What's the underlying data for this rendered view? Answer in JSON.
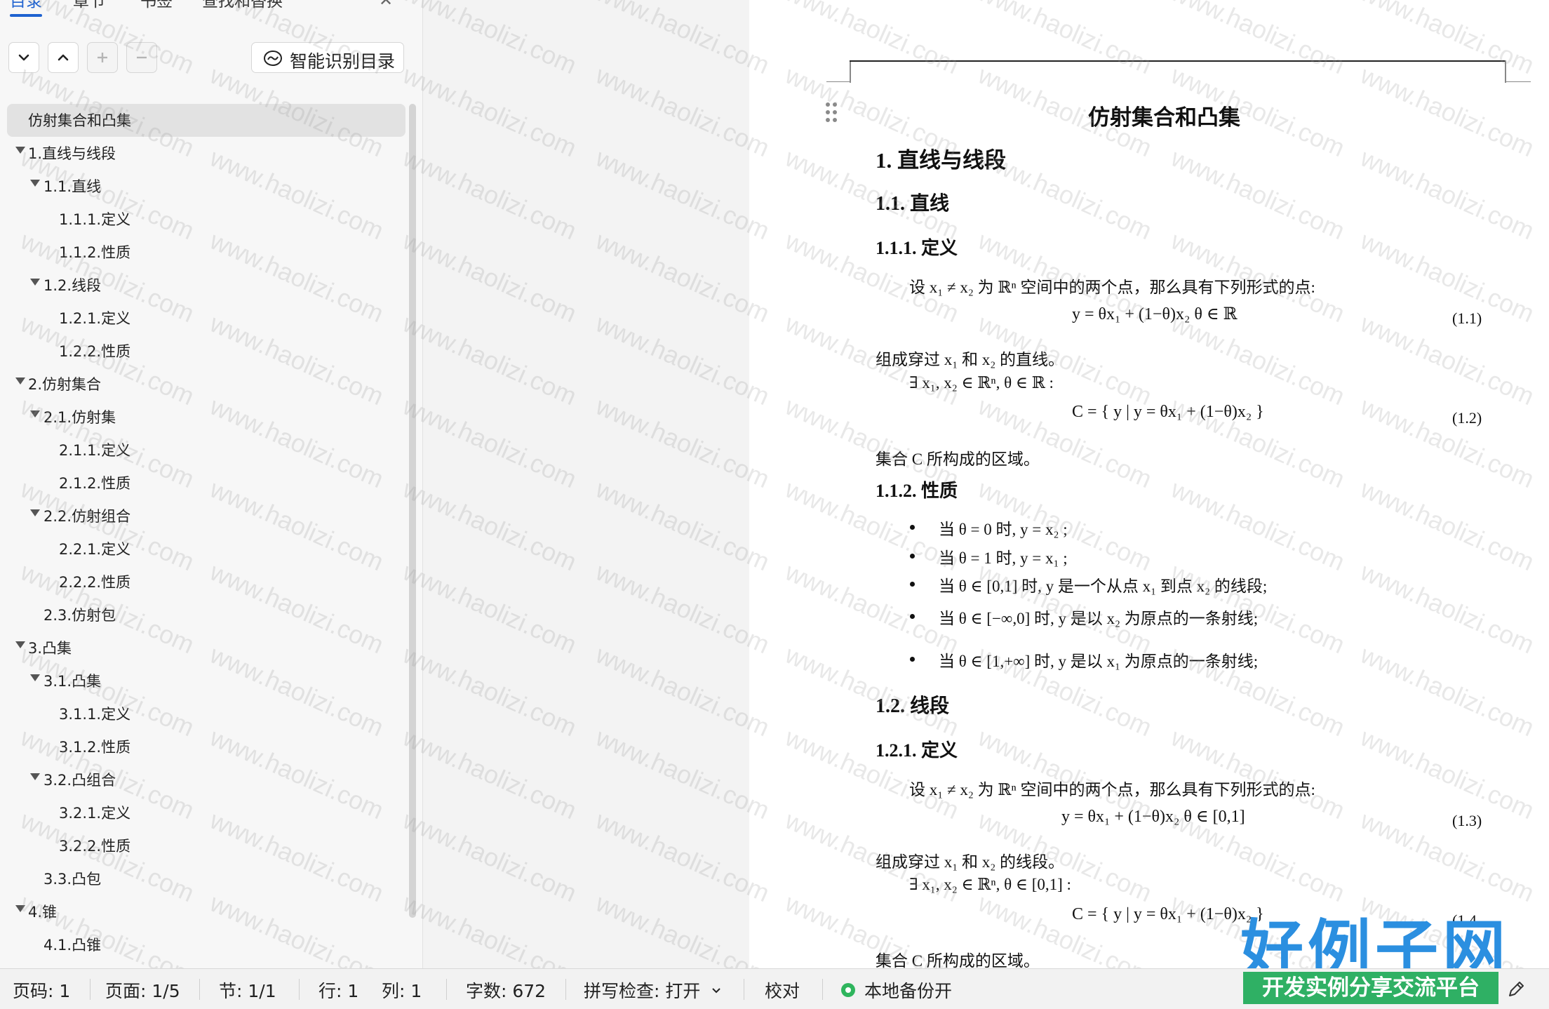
{
  "nav": {
    "tabs": [
      "目录",
      "章节",
      "书签",
      "查找和替换"
    ],
    "ai_toc_button": "智能识别目录",
    "toc": [
      {
        "label": "仿射集合和凸集",
        "level": 0,
        "arrow": false,
        "selected": true
      },
      {
        "label": "1.直线与线段",
        "level": 0,
        "arrow": true
      },
      {
        "label": "1.1.直线",
        "level": 1,
        "arrow": true
      },
      {
        "label": "1.1.1.定义",
        "level": 2,
        "arrow": false
      },
      {
        "label": "1.1.2.性质",
        "level": 2,
        "arrow": false
      },
      {
        "label": "1.2.线段",
        "level": 1,
        "arrow": true
      },
      {
        "label": "1.2.1.定义",
        "level": 2,
        "arrow": false
      },
      {
        "label": "1.2.2.性质",
        "level": 2,
        "arrow": false
      },
      {
        "label": "2.仿射集合",
        "level": 0,
        "arrow": true
      },
      {
        "label": "2.1.仿射集",
        "level": 1,
        "arrow": true
      },
      {
        "label": "2.1.1.定义",
        "level": 2,
        "arrow": false
      },
      {
        "label": "2.1.2.性质",
        "level": 2,
        "arrow": false
      },
      {
        "label": "2.2.仿射组合",
        "level": 1,
        "arrow": true
      },
      {
        "label": "2.2.1.定义",
        "level": 2,
        "arrow": false
      },
      {
        "label": "2.2.2.性质",
        "level": 2,
        "arrow": false
      },
      {
        "label": "2.3.仿射包",
        "level": 1,
        "arrow": false
      },
      {
        "label": "3.凸集",
        "level": 0,
        "arrow": true
      },
      {
        "label": "3.1.凸集",
        "level": 1,
        "arrow": true
      },
      {
        "label": "3.1.1.定义",
        "level": 2,
        "arrow": false
      },
      {
        "label": "3.1.2.性质",
        "level": 2,
        "arrow": false
      },
      {
        "label": "3.2.凸组合",
        "level": 1,
        "arrow": true
      },
      {
        "label": "3.2.1.定义",
        "level": 2,
        "arrow": false
      },
      {
        "label": "3.2.2.性质",
        "level": 2,
        "arrow": false
      },
      {
        "label": "3.3.凸包",
        "level": 1,
        "arrow": false
      },
      {
        "label": "4.锥",
        "level": 0,
        "arrow": true
      },
      {
        "label": "4.1.凸锥",
        "level": 1,
        "arrow": false
      }
    ]
  },
  "document": {
    "title": "仿射集合和凸集",
    "h1_1": "1.  直线与线段",
    "h2_11": "1.1. 直线",
    "h3_111": "1.1.1. 定义",
    "p1": "设 x₁ ≠ x₂ 为 ℝⁿ 空间中的两个点，那么具有下列形式的点:",
    "eq1": "y = θx₁ + (1−θ)x₂     θ ∈ ℝ",
    "eq1_num": "(1.1)",
    "p2": "组成穿过 x₁ 和 x₂ 的直线。",
    "p3": "∃ x₁, x₂ ∈ ℝⁿ,   θ ∈ ℝ :",
    "eq2": "C = { y | y = θx₁ + (1−θ)x₂ }",
    "eq2_num": "(1.2)",
    "p4": "集合 C 所构成的区域。",
    "h3_112": "1.1.2. 性质",
    "bullets": [
      "当 θ = 0 时,   y = x₂ ;",
      "当 θ = 1 时,   y = x₁ ;",
      "当 θ ∈ [0,1] 时,   y 是一个从点 x₁ 到点 x₂ 的线段;",
      "当 θ ∈ [−∞,0] 时,   y 是以 x₂ 为原点的一条射线;",
      "当 θ ∈ [1,+∞] 时,   y 是以 x₁ 为原点的一条射线;"
    ],
    "h2_12": "1.2. 线段",
    "h3_121": "1.2.1. 定义",
    "p5": "设 x₁ ≠ x₂ 为 ℝⁿ 空间中的两个点，那么具有下列形式的点:",
    "eq3": "y = θx₁ + (1−θ)x₂     θ ∈ [0,1]",
    "eq3_num": "(1.3)",
    "p6": "组成穿过 x₁ 和 x₂ 的线段。",
    "p7": "∃ x₁, x₂ ∈ ℝⁿ,   θ ∈ [0,1] :",
    "eq4": "C = { y | y = θx₁ + (1−θ)x₂ }",
    "eq4_num": "(1.4",
    "p8": "集合 C 所构成的区域。"
  },
  "watermark": "www.haolizi.com",
  "brand": {
    "title": "好例子网",
    "subtitle": "开发实例分享交流平台"
  },
  "statusbar": {
    "page_code": "页码: 1",
    "page": "页面: 1/5",
    "section": "节: 1/1",
    "row": "行: 1",
    "col": "列: 1",
    "word_count": "字数: 672",
    "spell_check": "拼写检查: 打开",
    "proofread": "校对",
    "backup": "本地备份开"
  },
  "colors": {
    "accent": "#1e62d0",
    "backup_green": "#2fb55d",
    "brand_blue": "#2b8fe0",
    "brand_green": "#2fb064"
  }
}
